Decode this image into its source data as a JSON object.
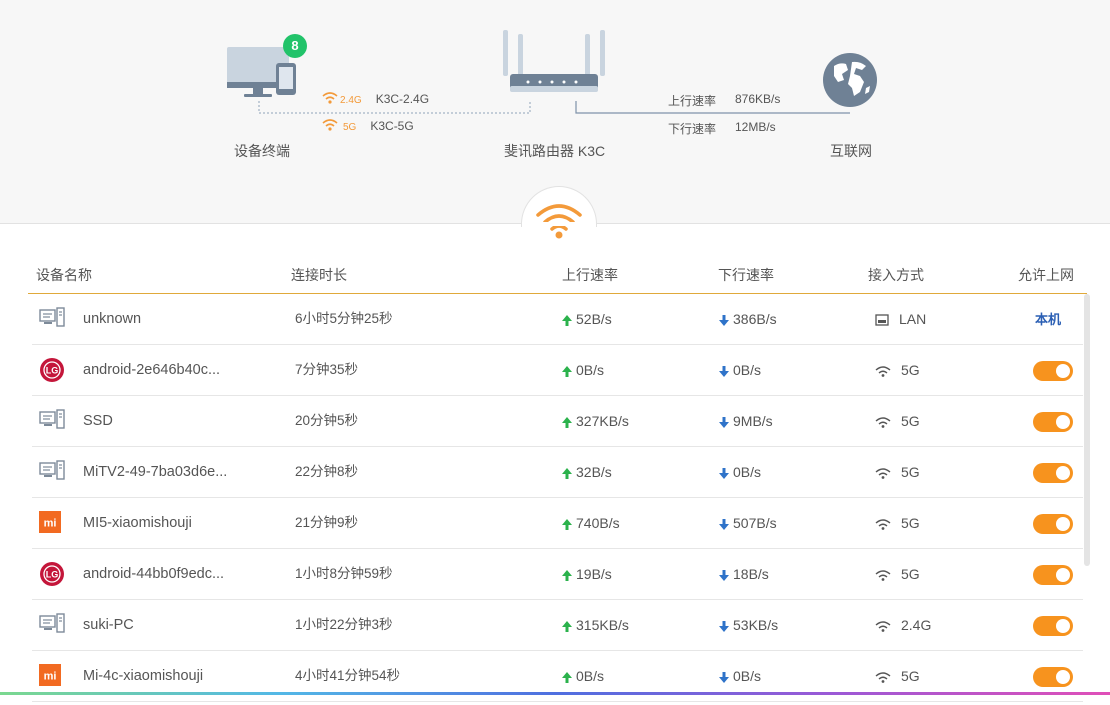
{
  "topology": {
    "device_count": "8",
    "device_label": "设备终端",
    "router_label": "斐讯路由器 K3C",
    "internet_label": "互联网",
    "band_24": {
      "freq": "2.4G",
      "ssid": "K3C-2.4G"
    },
    "band_5": {
      "freq": "5G",
      "ssid": "K3C-5G"
    },
    "upload_label": "上行速率",
    "upload_value": "876KB/s",
    "download_label": "下行速率",
    "download_value": "12MB/s"
  },
  "table": {
    "headers": {
      "name": "设备名称",
      "duration": "连接时长",
      "up": "上行速率",
      "down": "下行速率",
      "conn": "接入方式",
      "allow": "允许上网"
    },
    "local_label": "本机",
    "rows": [
      {
        "icon": "pc",
        "name": "unknown",
        "duration": "6小时5分钟25秒",
        "up": "52B/s",
        "down": "386B/s",
        "conn": "LAN",
        "conn_type": "lan",
        "allow": "local"
      },
      {
        "icon": "lg",
        "name": "android-2e646b40c...",
        "duration": "7分钟35秒",
        "up": "0B/s",
        "down": "0B/s",
        "conn": "5G",
        "conn_type": "wifi",
        "allow": "on"
      },
      {
        "icon": "pc",
        "name": "SSD",
        "duration": "20分钟5秒",
        "up": "327KB/s",
        "down": "9MB/s",
        "conn": "5G",
        "conn_type": "wifi",
        "allow": "on"
      },
      {
        "icon": "pc",
        "name": "MiTV2-49-7ba03d6e...",
        "duration": "22分钟8秒",
        "up": "32B/s",
        "down": "0B/s",
        "conn": "5G",
        "conn_type": "wifi",
        "allow": "on"
      },
      {
        "icon": "mi",
        "name": "MI5-xiaomishouji",
        "duration": "21分钟9秒",
        "up": "740B/s",
        "down": "507B/s",
        "conn": "5G",
        "conn_type": "wifi",
        "allow": "on"
      },
      {
        "icon": "lg",
        "name": "android-44bb0f9edc...",
        "duration": "1小时8分钟59秒",
        "up": "19B/s",
        "down": "18B/s",
        "conn": "5G",
        "conn_type": "wifi",
        "allow": "on"
      },
      {
        "icon": "pc",
        "name": "suki-PC",
        "duration": "1小时22分钟3秒",
        "up": "315KB/s",
        "down": "53KB/s",
        "conn": "2.4G",
        "conn_type": "wifi",
        "allow": "on"
      },
      {
        "icon": "mi",
        "name": "Mi-4c-xiaomishouji",
        "duration": "4小时41分钟54秒",
        "up": "0B/s",
        "down": "0B/s",
        "conn": "5G",
        "conn_type": "wifi",
        "allow": "on"
      }
    ]
  },
  "colors": {
    "accent": "#f7931e",
    "up_arrow": "#2bb24c",
    "down_arrow": "#2f73c9",
    "badge": "#22c36a",
    "local_link": "#2b5fb4"
  }
}
